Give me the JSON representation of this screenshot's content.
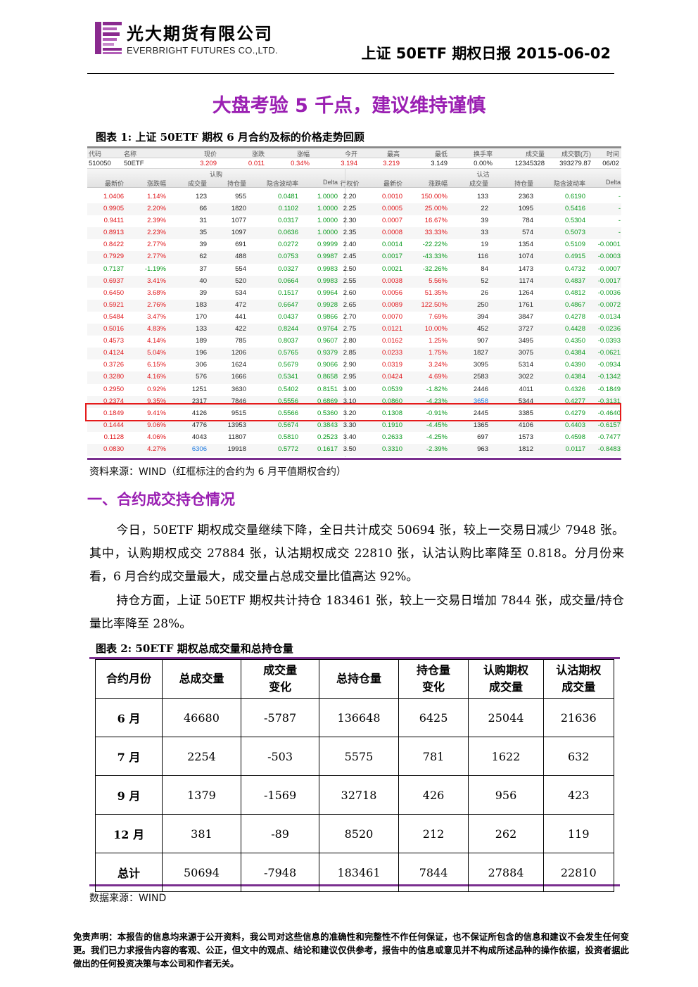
{
  "header": {
    "company_cn": "光大期货有限公司",
    "company_en": "EVERBRIGHT FUTURES CO.,LTD.",
    "report_title": "上证 50ETF 期权日报 2015-06-02",
    "logo_icon": "everbright-logo-icon",
    "brand_color": "#9a1fb2"
  },
  "main_title": "大盘考验 5 千点，建议维持谨慎",
  "figure1": {
    "caption": "图表 1:  上证 50ETF 期权 6 月合约及标的价格走势回顾",
    "underlying_headers": [
      "代码",
      "名称",
      "现价",
      "涨跌",
      "涨幅",
      "今开",
      "最高",
      "最低",
      "换手率",
      "成交量",
      "成交额(万)",
      "时间"
    ],
    "underlying_values": [
      "510050",
      "50ETF",
      "3.209",
      "0.011",
      "0.34%",
      "3.194",
      "3.219",
      "3.149",
      "0.00%",
      "12345328",
      "393279.87",
      "06/02"
    ],
    "call_label": "认购",
    "put_label": "认沽",
    "col_headers": [
      "最新价",
      "涨跌幅",
      "成交量",
      "持仓量",
      "隐含波动率",
      "Delta",
      "行权价",
      "最新价",
      "涨跌幅",
      "成交量",
      "持仓量",
      "隐含波动率",
      "Delta"
    ],
    "rows": [
      [
        "1.0406",
        "1.14%",
        "123",
        "955",
        "0.0481",
        "1.0000",
        "2.20",
        "0.0010",
        "150.00%",
        "133",
        "2363",
        "0.6190",
        "-"
      ],
      [
        "0.9905",
        "2.20%",
        "66",
        "1820",
        "0.1102",
        "1.0000",
        "2.25",
        "0.0005",
        "25.00%",
        "22",
        "1095",
        "0.5416",
        "-"
      ],
      [
        "0.9411",
        "2.39%",
        "31",
        "1077",
        "0.0317",
        "1.0000",
        "2.30",
        "0.0007",
        "16.67%",
        "39",
        "784",
        "0.5304",
        "-"
      ],
      [
        "0.8913",
        "2.23%",
        "35",
        "1097",
        "0.0636",
        "1.0000",
        "2.35",
        "0.0008",
        "33.33%",
        "33",
        "574",
        "0.5073",
        "-"
      ],
      [
        "0.8422",
        "2.77%",
        "39",
        "691",
        "0.0272",
        "0.9999",
        "2.40",
        "0.0014",
        "-22.22%",
        "19",
        "1354",
        "0.5109",
        "-0.0001"
      ],
      [
        "0.7929",
        "2.77%",
        "62",
        "488",
        "0.0753",
        "0.9987",
        "2.45",
        "0.0017",
        "-43.33%",
        "116",
        "1074",
        "0.4915",
        "-0.0003"
      ],
      [
        "0.7137",
        "-1.19%",
        "37",
        "554",
        "0.0327",
        "0.9983",
        "2.50",
        "0.0021",
        "-32.26%",
        "84",
        "1473",
        "0.4732",
        "-0.0007"
      ],
      [
        "0.6937",
        "3.41%",
        "40",
        "520",
        "0.0664",
        "0.9983",
        "2.55",
        "0.0038",
        "5.56%",
        "52",
        "1174",
        "0.4837",
        "-0.0017"
      ],
      [
        "0.6450",
        "3.68%",
        "39",
        "534",
        "0.1517",
        "0.9964",
        "2.60",
        "0.0056",
        "51.35%",
        "26",
        "1264",
        "0.4812",
        "-0.0036"
      ],
      [
        "0.5921",
        "2.76%",
        "183",
        "472",
        "0.6647",
        "0.9928",
        "2.65",
        "0.0089",
        "122.50%",
        "250",
        "1761",
        "0.4867",
        "-0.0072"
      ],
      [
        "0.5484",
        "3.47%",
        "170",
        "441",
        "0.0437",
        "0.9866",
        "2.70",
        "0.0070",
        "7.69%",
        "394",
        "3847",
        "0.4278",
        "-0.0134"
      ],
      [
        "0.5016",
        "4.83%",
        "133",
        "422",
        "0.8244",
        "0.9764",
        "2.75",
        "0.0121",
        "10.00%",
        "452",
        "3727",
        "0.4428",
        "-0.0236"
      ],
      [
        "0.4573",
        "4.14%",
        "189",
        "785",
        "0.8037",
        "0.9607",
        "2.80",
        "0.0162",
        "1.25%",
        "907",
        "3495",
        "0.4350",
        "-0.0393"
      ],
      [
        "0.4124",
        "5.04%",
        "196",
        "1206",
        "0.5765",
        "0.9379",
        "2.85",
        "0.0233",
        "1.75%",
        "1827",
        "3075",
        "0.4384",
        "-0.0621"
      ],
      [
        "0.3726",
        "6.15%",
        "306",
        "1624",
        "0.5679",
        "0.9066",
        "2.90",
        "0.0319",
        "3.24%",
        "3095",
        "5314",
        "0.4390",
        "-0.0934"
      ],
      [
        "0.3280",
        "4.16%",
        "576",
        "1666",
        "0.5341",
        "0.8658",
        "2.95",
        "0.0424",
        "4.69%",
        "2583",
        "3022",
        "0.4384",
        "-0.1342"
      ],
      [
        "0.2950",
        "0.92%",
        "1251",
        "3630",
        "0.5402",
        "0.8151",
        "3.00",
        "0.0539",
        "-1.82%",
        "2446",
        "4011",
        "0.4326",
        "-0.1849"
      ],
      [
        "0.2374",
        "9.35%",
        "2317",
        "7846",
        "0.5556",
        "0.6869",
        "3.10",
        "0.0860",
        "-4.23%",
        "3658",
        "5344",
        "0.4277",
        "-0.3131"
      ],
      [
        "0.1849",
        "9.41%",
        "4126",
        "9515",
        "0.5566",
        "0.5360",
        "3.20",
        "0.1308",
        "-0.91%",
        "2445",
        "3385",
        "0.4279",
        "-0.4640"
      ],
      [
        "0.1444",
        "9.06%",
        "4776",
        "13953",
        "0.5674",
        "0.3843",
        "3.30",
        "0.1910",
        "-4.45%",
        "1365",
        "4106",
        "0.4403",
        "-0.6157"
      ],
      [
        "0.1128",
        "4.06%",
        "4043",
        "11807",
        "0.5810",
        "0.2523",
        "3.40",
        "0.2633",
        "-4.25%",
        "697",
        "1573",
        "0.4598",
        "-0.7477"
      ],
      [
        "0.0830",
        "4.27%",
        "6306",
        "19918",
        "0.5772",
        "0.1617",
        "3.50",
        "0.3310",
        "-2.39%",
        "963",
        "1812",
        "0.0117",
        "-0.8483"
      ]
    ],
    "source": "资料来源：WIND（红框标注的合约为 6 月平值期权合约）",
    "up_color": "#e0161b",
    "down_color": "#0b9a1f",
    "highlight_color": "#e51b1b"
  },
  "section1": {
    "heading": "一、合约成交持仓情况",
    "para1": "今日，50ETF 期权成交量继续下降，全日共计成交 50694 张，较上一交易日减少 7948 张。其中，认购期权成交 27884 张，认沽期权成交 22810 张，认沽认购比率降至 0.818。分月份来看，6 月合约成交量最大，成交量占总成交量比值高达 92%。",
    "para2": "持仓方面，上证 50ETF 期权共计持仓 183461 张，较上一交易日增加 7844 张，成交量/持仓量比率降至 28%。"
  },
  "figure2": {
    "caption": "图表 2:  50ETF 期权总成交量和总持仓量",
    "headers": [
      "合约月份",
      "总成交量",
      "成交量变化",
      "总持仓量",
      "持仓量变化",
      "认购期权成交量",
      "认沽期权成交量"
    ],
    "headers_line1": [
      "合约月份",
      "总成交量",
      "成交量",
      "总持仓量",
      "持仓量",
      "认购期权",
      "认沽期权"
    ],
    "headers_line2": [
      "",
      "",
      "变化",
      "",
      "变化",
      "成交量",
      "成交量"
    ],
    "rows": [
      [
        "6 月",
        "46680",
        "-5787",
        "136648",
        "6425",
        "25044",
        "21636"
      ],
      [
        "7 月",
        "2254",
        "-503",
        "5575",
        "781",
        "1622",
        "632"
      ],
      [
        "9 月",
        "1379",
        "-1569",
        "32718",
        "426",
        "956",
        "423"
      ],
      [
        "12 月",
        "381",
        "-89",
        "8520",
        "212",
        "262",
        "119"
      ],
      [
        "总计",
        "50694",
        "-7948",
        "183461",
        "7844",
        "27884",
        "22810"
      ]
    ],
    "source": "数据来源：WIND",
    "border_color": "#7a2f8f"
  },
  "disclaimer": "免责声明：本报告的信息均来源于公开资料，我公司对这些信息的准确性和完整性不作任何保证，也不保证所包含的信息和建议不会发生任何变更。我们已力求报告内容的客观、公正，但文中的观点、结论和建议仅供参考，报告中的信息或意见并不构成所述品种的操作依据，投资者据此做出的任何投资决策与本公司和作者无关。"
}
